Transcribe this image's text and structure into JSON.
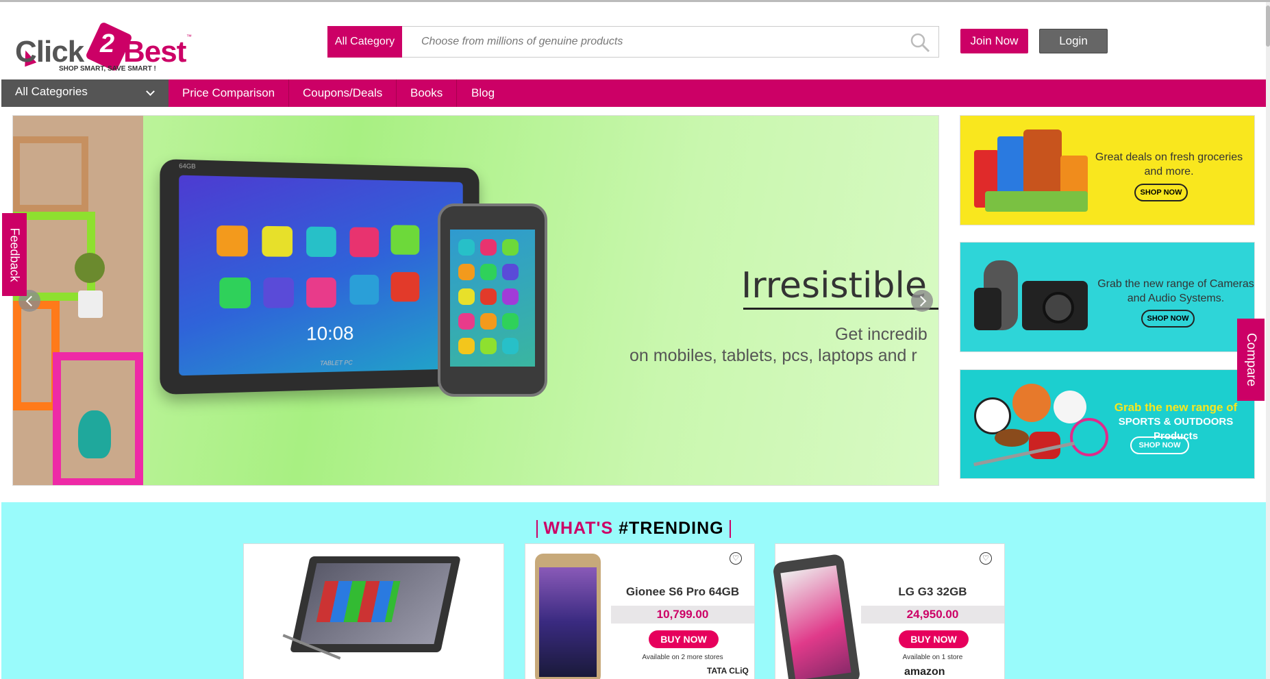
{
  "logo": {
    "word1": "Click",
    "number": "2",
    "word2": "Best",
    "trademark": "™",
    "tagline": "SHOP SMART, SAVE SMART !"
  },
  "search": {
    "category_label": "All Category",
    "placeholder": "Choose from millions of genuine products"
  },
  "header": {
    "join_label": "Join Now",
    "login_label": "Login"
  },
  "nav": {
    "all_categories": "All Categories",
    "items": [
      "Price Comparison",
      "Coupons/Deals",
      "Books",
      "Blog"
    ]
  },
  "slider": {
    "title": "Irresistible Ga",
    "sub1": "Get incredib",
    "sub2": "on mobiles, tablets, pcs, laptops and r",
    "tablet_clock": "10:08",
    "tablet_brand": "TABLET PC",
    "tablet_storage": "64GB"
  },
  "side_tabs": {
    "feedback": "Feedback",
    "compare": "Compare"
  },
  "promos": [
    {
      "text_line1": "Great deals on fresh groceries",
      "text_line2": "and more.",
      "button": "SHOP NOW",
      "bg": "#f9e71e"
    },
    {
      "text_line1": "Grab the new range of Cameras",
      "text_line2": "and Audio Systems.",
      "button": "SHOP NOW",
      "bg": "#2ed5d8"
    },
    {
      "text_line1": "Grab the new range of",
      "text_line2": "SPORTS & OUTDOORS Products",
      "button": "SHOP NOW",
      "bg": "#1ccfcf"
    }
  ],
  "trending": {
    "title_part1": "WHAT'S",
    "title_part2": "#TRENDING",
    "products": [
      {
        "name": "Gionee S6 Pro 64GB",
        "price": "10,799.00",
        "buy": "BUY NOW",
        "availability": "Available on 2 more stores",
        "store": "TATA CLiQ"
      },
      {
        "name": "LG G3 32GB",
        "price": "24,950.00",
        "buy": "BUY NOW",
        "availability": "Available on 1 store",
        "store": "amazon"
      }
    ]
  },
  "colors": {
    "brand": "#cc0066",
    "trending_bg": "#99fbfb",
    "nav_dark": "#555555"
  }
}
